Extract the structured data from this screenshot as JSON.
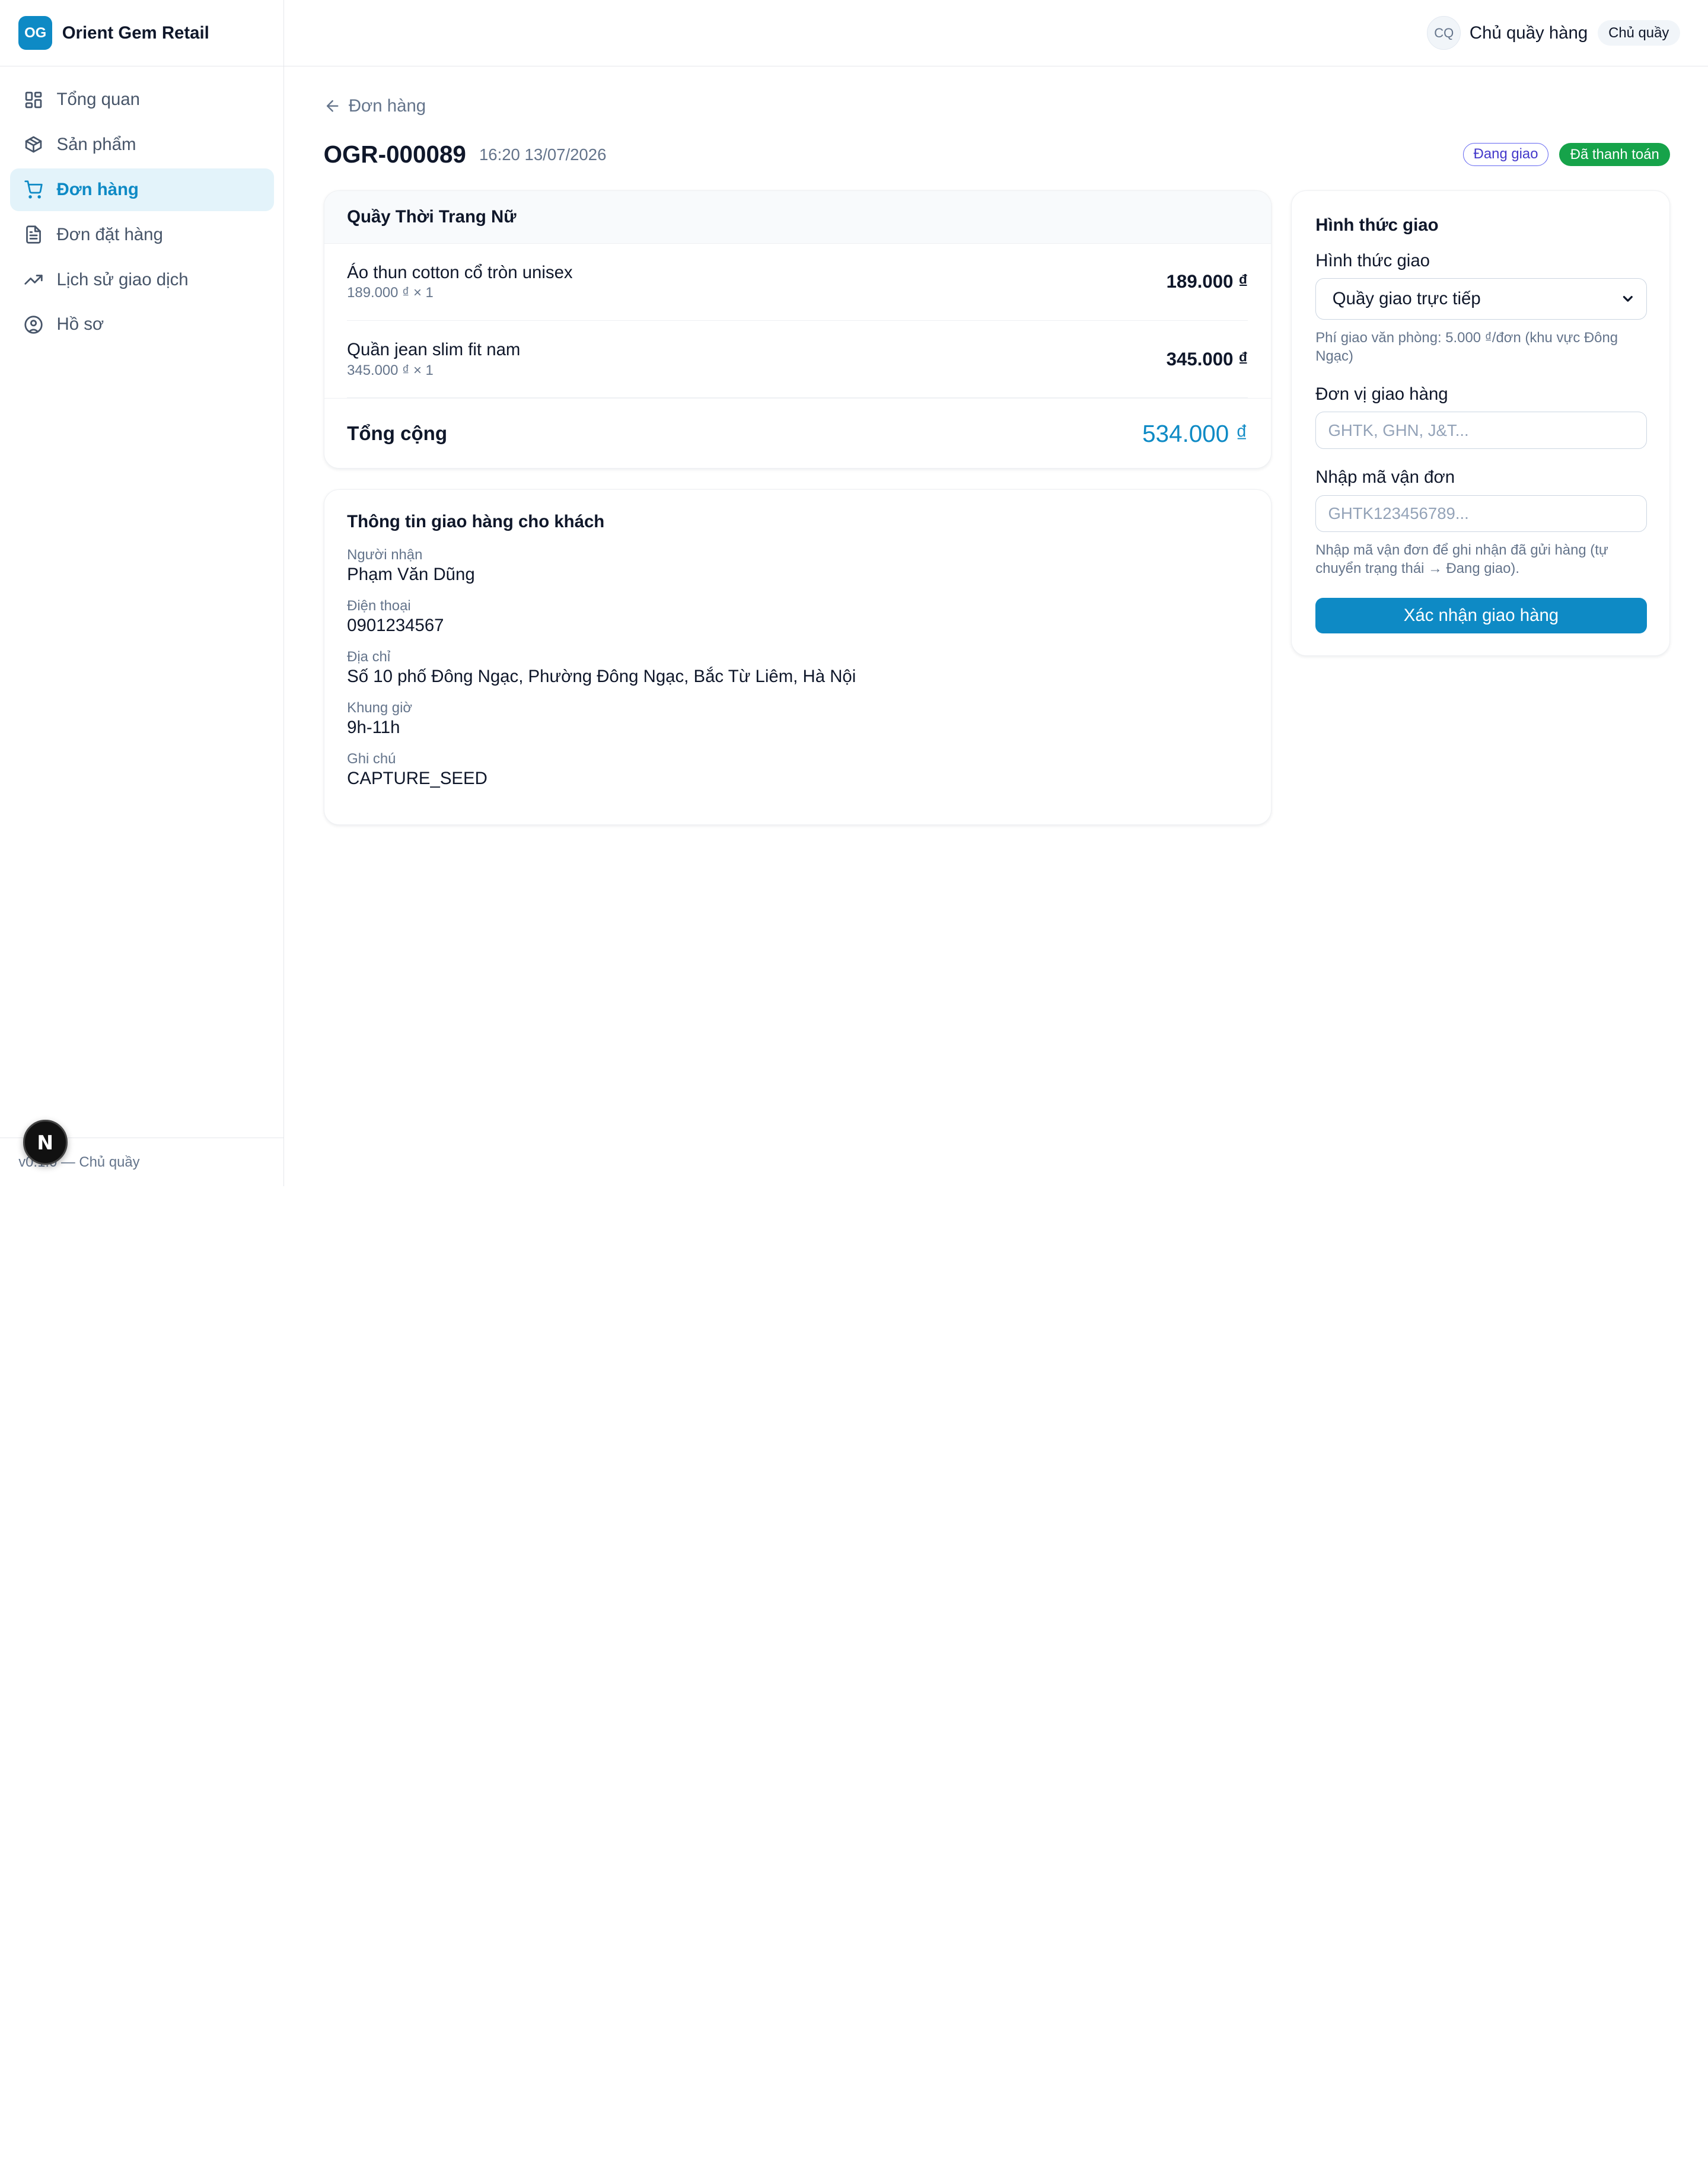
{
  "brand": {
    "logo": "OG",
    "name": "Orient Gem Retail"
  },
  "nav": {
    "items": [
      {
        "label": "Tổng quan",
        "icon": "dashboard-icon"
      },
      {
        "label": "Sản phẩm",
        "icon": "package-icon"
      },
      {
        "label": "Đơn hàng",
        "icon": "cart-icon",
        "active": true
      },
      {
        "label": "Đơn đặt hàng",
        "icon": "document-icon"
      },
      {
        "label": "Lịch sử giao dịch",
        "icon": "trending-icon"
      },
      {
        "label": "Hồ sơ",
        "icon": "user-circle-icon"
      }
    ]
  },
  "footer": {
    "version": "v0.1.0 — Chủ quầy",
    "next_badge": "N"
  },
  "topbar": {
    "avatar": "CQ",
    "user_name": "Chủ quầy hàng",
    "role": "Chủ quầy"
  },
  "order": {
    "back_label": "Đơn hàng",
    "id": "OGR-000089",
    "time": "16:20 13/07/2026",
    "status_shipping": "Đang giao",
    "status_payment": "Đã thanh toán"
  },
  "items_card": {
    "title": "Quầy Thời Trang Nữ",
    "items": [
      {
        "name": "Áo thun cotton cổ tròn unisex",
        "sub": "189.000 ₫ × 1",
        "price": "189.000 ₫"
      },
      {
        "name": "Quần jean slim fit nam",
        "sub": "345.000 ₫ × 1",
        "price": "345.000 ₫"
      }
    ],
    "total_label": "Tổng cộng",
    "total_value": "534.000 ₫"
  },
  "shipping_info": {
    "title": "Thông tin giao hàng cho khách",
    "fields": [
      {
        "label": "Người nhận",
        "value": "Phạm Văn Dũng"
      },
      {
        "label": "Điện thoại",
        "value": "0901234567"
      },
      {
        "label": "Địa chỉ",
        "value": "Số 10 phố Đông Ngạc, Phường Đông Ngạc, Bắc Từ Liêm, Hà Nội"
      },
      {
        "label": "Khung giờ",
        "value": "9h-11h"
      },
      {
        "label": "Ghi chú",
        "value": "CAPTURE_SEED"
      }
    ]
  },
  "delivery": {
    "title": "Hình thức giao",
    "method_label": "Hình thức giao",
    "method_value": "Quầy giao trực tiếp",
    "method_hint": "Phí giao văn phòng: 5.000 ₫/đơn (khu vực Đông Ngạc)",
    "carrier_label": "Đơn vị giao hàng",
    "carrier_placeholder": "GHTK, GHN, J&T...",
    "tracking_label": "Nhập mã vận đơn",
    "tracking_placeholder": "GHTK123456789...",
    "tracking_hint": "Nhập mã vận đơn để ghi nhận đã gửi hàng (tự chuyển trạng thái → Đang giao).",
    "confirm_label": "Xác nhận giao hàng"
  }
}
